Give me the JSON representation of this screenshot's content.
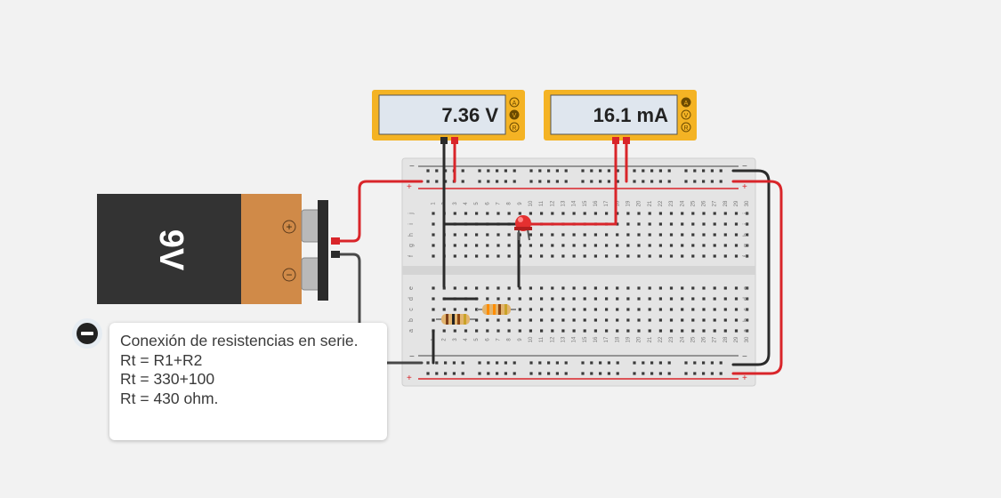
{
  "battery": {
    "label": "9V",
    "plus_symbol": "+",
    "minus_symbol": "−"
  },
  "multimeters": [
    {
      "reading": "7.36 V",
      "modes": [
        "A",
        "V",
        "R"
      ],
      "active_mode": "V"
    },
    {
      "reading": "16.1 mA",
      "modes": [
        "A",
        "V",
        "R"
      ],
      "active_mode": "A"
    }
  ],
  "breadboard": {
    "rail_minus": "−",
    "rail_plus": "+",
    "top_rows": [
      "j",
      "i",
      "h",
      "g",
      "f"
    ],
    "bottom_rows": [
      "e",
      "d",
      "c",
      "b",
      "a"
    ],
    "columns": [
      "1",
      "2",
      "3",
      "4",
      "5",
      "6",
      "7",
      "8",
      "9",
      "10",
      "11",
      "12",
      "13",
      "14",
      "15",
      "16",
      "17",
      "18",
      "19",
      "20",
      "21",
      "22",
      "23",
      "24",
      "25",
      "26",
      "27",
      "28",
      "29",
      "30"
    ]
  },
  "note": {
    "lines": [
      "Conexión de resistencias en serie.",
      "Rt = R1+R2",
      "Rt = 330+100",
      "Rt = 430 ohm."
    ]
  },
  "colors": {
    "background": "#f2f2f2",
    "wire_red": "#d9252a",
    "wire_black": "#2b2b2b",
    "multimeter_body": "#f4b324",
    "battery_body": "#333333",
    "battery_label": "#d08a48",
    "led": "#e53030",
    "breadboard": "#e4e4e4"
  }
}
